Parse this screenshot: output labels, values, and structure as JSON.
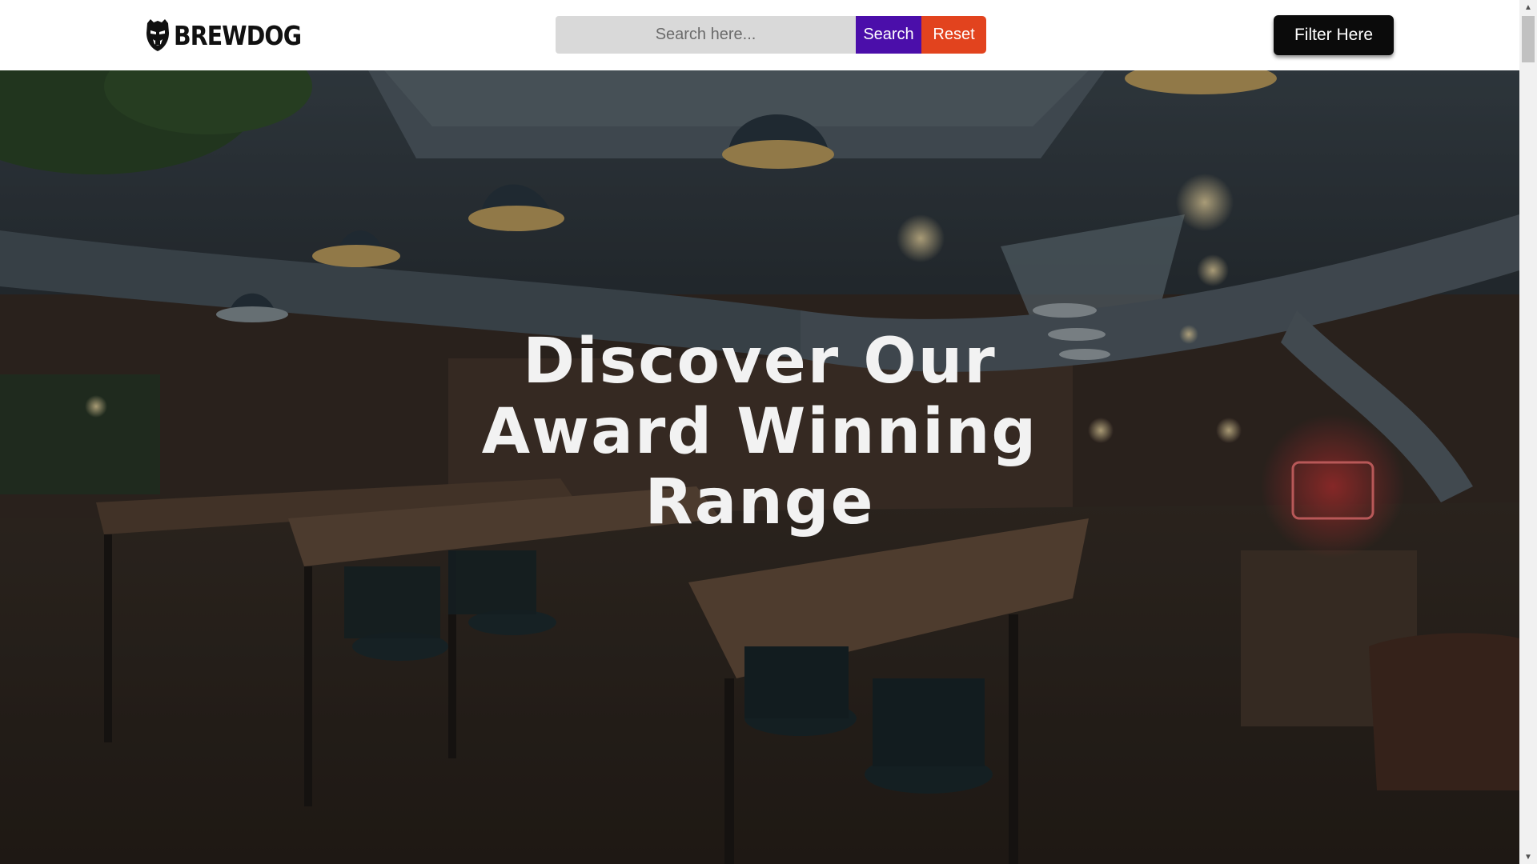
{
  "header": {
    "logo_text": "BREWDOG",
    "search": {
      "placeholder": "Search here...",
      "value": ""
    },
    "search_button_label": "Search",
    "reset_button_label": "Reset",
    "filter_button_label": "Filter Here"
  },
  "hero": {
    "title_lines": [
      "Discover Our",
      "Award Winning",
      "Range"
    ],
    "background_image": "dim bar interior with long wooden tables, high stools, hanging pendant lamps and ceiling ducts"
  },
  "icons": {
    "logo": "brewdog-head-icon",
    "scroll_up": "scroll-up-arrow-icon",
    "scroll_down": "scroll-down-arrow-icon"
  },
  "colors": {
    "search_button": "#4b0eaa",
    "reset_button": "#e2431e",
    "filter_button": "#0b0b0b",
    "search_field": "#d9d9d9",
    "hero_text": "#f2f2f2"
  }
}
